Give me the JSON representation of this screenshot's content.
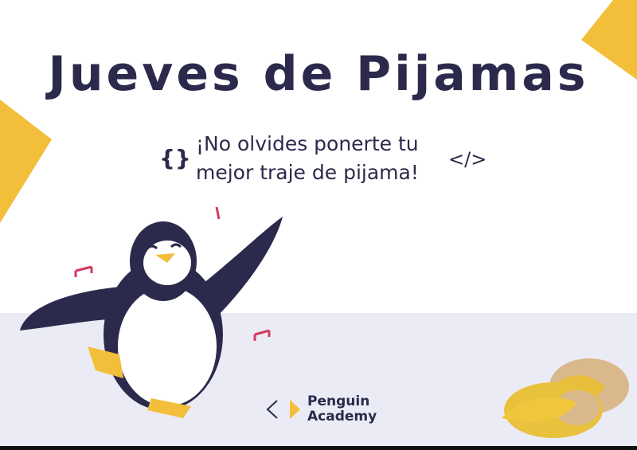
{
  "title": "Jueves de Pijamas",
  "subtitle": {
    "line1": "¡No olvides ponerte tu",
    "line2": "mejor traje de pijama!"
  },
  "decor": {
    "braces": "{}",
    "code_tag": "</>"
  },
  "logo": {
    "line1": "Penguin",
    "line2": "Academy"
  },
  "colors": {
    "navy": "#2b2a4c",
    "yellow": "#f3bf3a",
    "floor": "#ebebf5",
    "note": "#d23a5c"
  }
}
